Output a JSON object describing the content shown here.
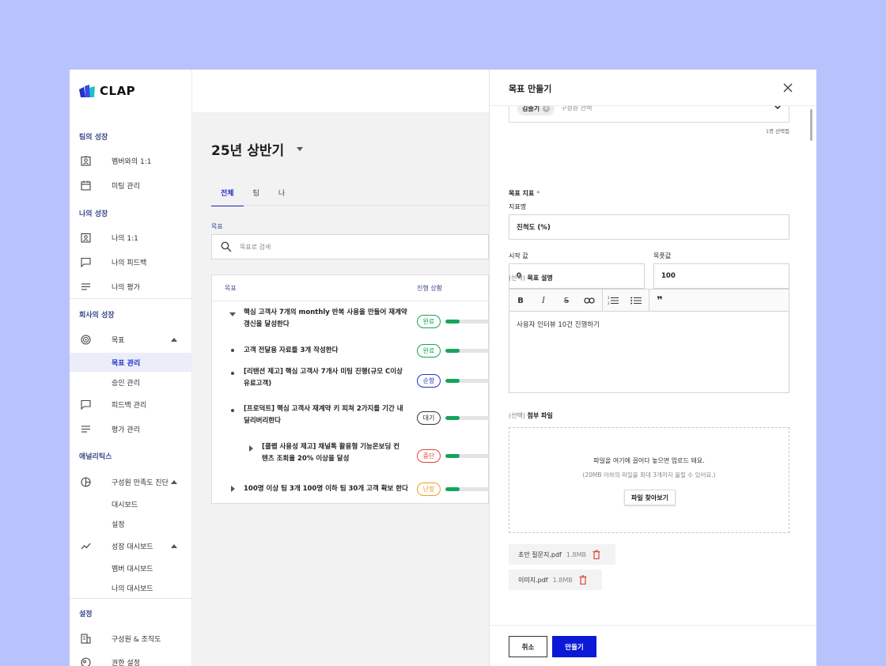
{
  "app": {
    "logo_text": "CLAP"
  },
  "sidebar": {
    "sections": [
      {
        "title": "팀의 성장"
      },
      {
        "title": "나의 성장"
      },
      {
        "title": "회사의 성장"
      },
      {
        "title": "애널리틱스"
      },
      {
        "title": "설정"
      }
    ],
    "items": {
      "member_1on1": "멤버와의 1:1",
      "meeting": "미팅 관리",
      "my_1on1": "나의 1:1",
      "my_feedback": "나의 피드백",
      "my_review": "나의 평가",
      "goal": "목표",
      "goal_manage": "목표 관리",
      "approval_manage": "승인 관리",
      "feedback_manage": "피드백 관리",
      "review_manage": "평가 관리",
      "member_satisfaction": "구성원 만족도 진단",
      "dashboard": "대시보드",
      "settings": "설정",
      "growth_dashboard": "성장 대시보드",
      "member_dashboard": "멤버 대시보드",
      "my_dashboard": "나의 대시보드",
      "members_org": "구성원 & 조직도",
      "permission": "권한 설정"
    }
  },
  "main": {
    "period": "25년 상반기",
    "tabs": [
      "전체",
      "팀",
      "나"
    ],
    "goal_label": "목표",
    "search_placeholder": "목표로 검색",
    "table": {
      "col_goal": "목표",
      "col_status": "진행 상황",
      "rows": [
        {
          "lines": [
            "핵심 고객사 7개의 monthly 반복 사용을 만들어 재계약",
            "갱신을 달성한다"
          ],
          "status": "완료",
          "progress": 0.3,
          "color": "#17a45b"
        },
        {
          "lines": [
            "고객 전달용 자료를 3개 작성한다"
          ],
          "status": "완료",
          "progress": 0.3,
          "color": "#17a45b"
        },
        {
          "lines": [
            "[리텐션 제고] 핵심 고객사 7개사 미팅 진행(규모 C이상",
            "유료고객)"
          ],
          "status": "순항",
          "progress": 0.3,
          "color": "#2330c8"
        },
        {
          "lines": [
            "[프로덕트] 핵심 고객사 재계약 키 피쳐 2가지를 기간 내",
            "딜리버리한다"
          ],
          "status": "대기",
          "progress": 0.3,
          "color": "#333333"
        },
        {
          "lines": [
            "[클랩 사용성 제고] 채널톡 활용형 기능온보딩 컨",
            "텐츠 조회율 20% 이상을 달성"
          ],
          "status": "중단",
          "progress": 0.3,
          "color": "#e0433a"
        },
        {
          "lines": [
            "100명 이상 팀 3개 100명 이하 팀 30개 고객 확보 한다"
          ],
          "status": "난항",
          "progress": 0.3,
          "color": "#f0a020"
        }
      ]
    }
  },
  "drawer": {
    "title": "목표 만들기",
    "member_chip": "김슬기",
    "member_placeholder": "구성원 선택",
    "member_count": "1명 선택됨",
    "metric_label": "목표 지표",
    "metric_name_label": "지표명",
    "metric_name_value": "진척도 (%)",
    "start_label": "시작 값",
    "start_value": "0",
    "target_label": "목푯값",
    "target_value": "100",
    "optional_tag": "(선택)",
    "desc_label": "목표 설명",
    "desc_value": "사용자 인터뷰 10건 진행하기",
    "attach_label": "첨부 파일",
    "drop_main": "파일을 여기에 끌어다 놓으면 업로드 돼요.",
    "drop_sub": "(20MB 이하의 파일을 최대 3개까지 올릴 수 있어요.)",
    "browse_label": "파일 찾아보기",
    "files": [
      {
        "name": "초안 질문지.pdf",
        "size": "1.8MB"
      },
      {
        "name": "이미지.pdf",
        "size": "1.8MB"
      }
    ],
    "cancel_label": "취소",
    "create_label": "만들기"
  },
  "colors": {
    "accent": "#2330c8",
    "primary_button": "#0b18d6",
    "background": "#b8c3fd",
    "progress": "#17a45b"
  }
}
